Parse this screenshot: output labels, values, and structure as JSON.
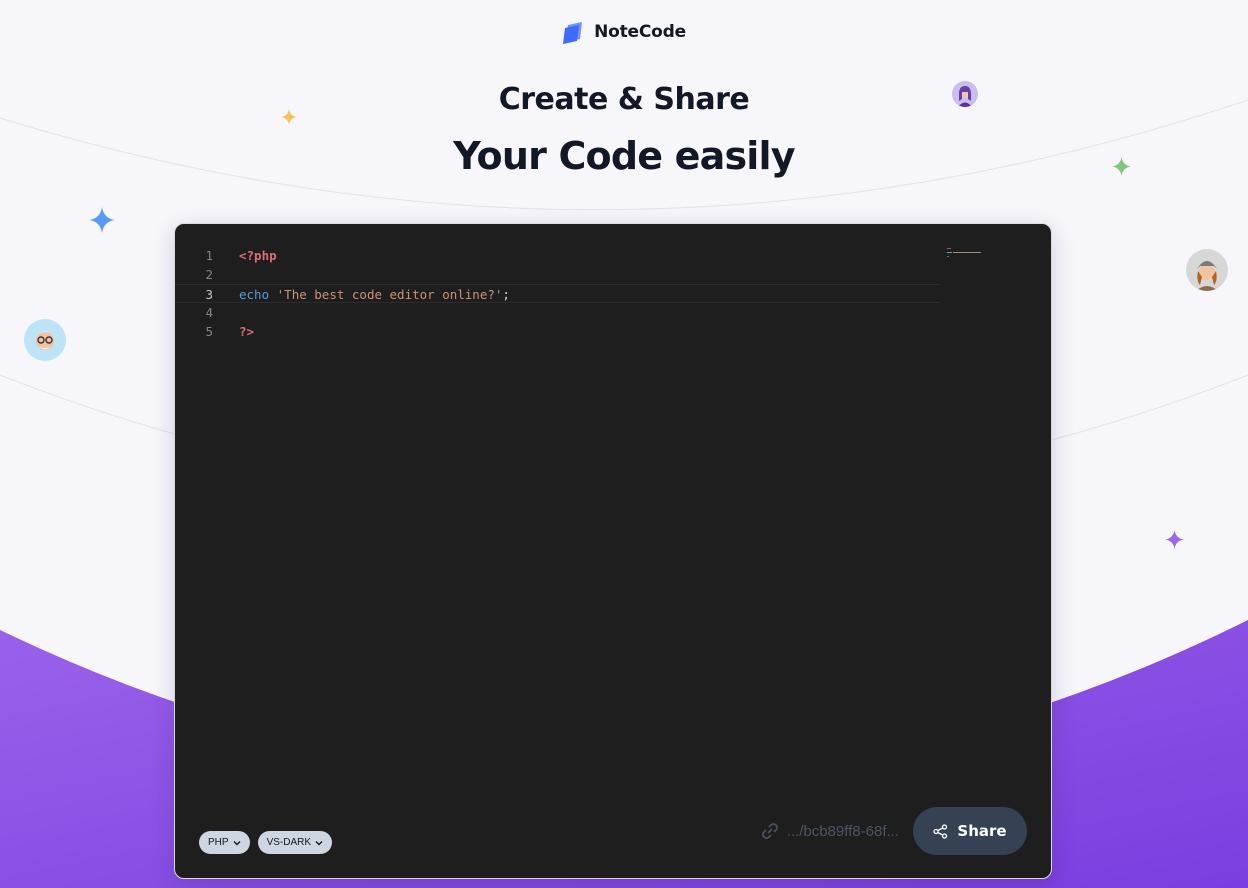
{
  "brand": {
    "name": "NoteCode",
    "logo_icon": "notecode-logo-icon",
    "accent_color": "#406AFF"
  },
  "hero": {
    "line1": "Create & Share",
    "line2": "Your Code easily"
  },
  "decorations": {
    "sparkles": [
      {
        "name": "sparkle-yellow-icon",
        "color": "#F8C060"
      },
      {
        "name": "sparkle-blue-icon",
        "color": "#5A9AF6"
      },
      {
        "name": "sparkle-green-icon",
        "color": "#7FC77A"
      },
      {
        "name": "sparkle-purple-icon",
        "color": "#A068E8"
      }
    ],
    "avatars": [
      "avatar-top-right",
      "avatar-right",
      "avatar-left"
    ],
    "wave_color": "#8B4FE6"
  },
  "editor": {
    "theme_background": "#1E1E1E",
    "current_line": "3",
    "lines": [
      {
        "number": "1",
        "tokens": [
          {
            "t": "<?php",
            "c": "tag"
          }
        ]
      },
      {
        "number": "2",
        "tokens": []
      },
      {
        "number": "3",
        "tokens": [
          {
            "t": "echo",
            "c": "kw"
          },
          {
            "t": " ",
            "c": "punct"
          },
          {
            "t": "'The best code editor online?'",
            "c": "str"
          },
          {
            "t": ";",
            "c": "punct"
          }
        ]
      },
      {
        "number": "4",
        "tokens": []
      },
      {
        "number": "5",
        "tokens": [
          {
            "t": "?>",
            "c": "tag"
          }
        ]
      }
    ],
    "language_select": {
      "selected": "PHP"
    },
    "theme_select": {
      "selected": "VS-DARK"
    },
    "share_link": {
      "text": ".../bcb89ff8-68f...",
      "icon": "link-icon"
    },
    "share_button": {
      "label": "Share",
      "icon": "share-icon"
    }
  }
}
